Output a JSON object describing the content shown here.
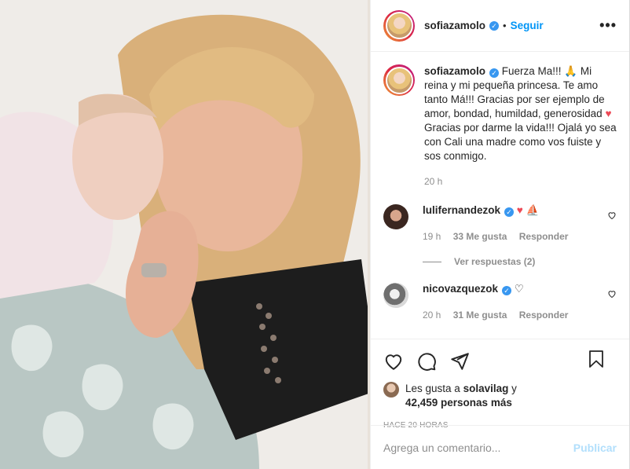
{
  "post": {
    "username": "sofiazamolo",
    "follow_label": "Seguir",
    "more_label": "•••",
    "photo_alt": "Post photo"
  },
  "caption": {
    "username": "sofiazamolo",
    "text_1": "Fuerza Ma!!! 🙏 Mi reina y mi pequeña princesa. Te amo tanto Má!!! Gracias por ser ejemplo de amor, bondad, humildad, generosidad",
    "heart": "♥",
    "text_2": "Gracias por darme la vida!!! Ojalá yo sea con Cali una madre como vos fuiste y sos conmigo.",
    "time": "20 h"
  },
  "comments": [
    {
      "username": "lulifernandezok",
      "text": "♥ ⛵",
      "time": "19 h",
      "likes": "33 Me gusta",
      "reply": "Responder",
      "view_replies": "Ver respuestas (2)"
    },
    {
      "username": "nicovazquezok",
      "text": "♡",
      "time": "20 h",
      "likes": "31 Me gusta",
      "reply": "Responder"
    }
  ],
  "likes": {
    "prefix": "Les gusta a",
    "user": "solavilag",
    "suffix": "y",
    "count": "42,459 personas más"
  },
  "posted_ago": "HACE 20 HORAS",
  "add_comment": {
    "placeholder": "Agrega un comentario...",
    "publish": "Publicar"
  },
  "colors": {
    "link": "#0095f6",
    "verified": "#3897f0",
    "secondary": "#8e8e8e",
    "heart": "#ed4956"
  }
}
